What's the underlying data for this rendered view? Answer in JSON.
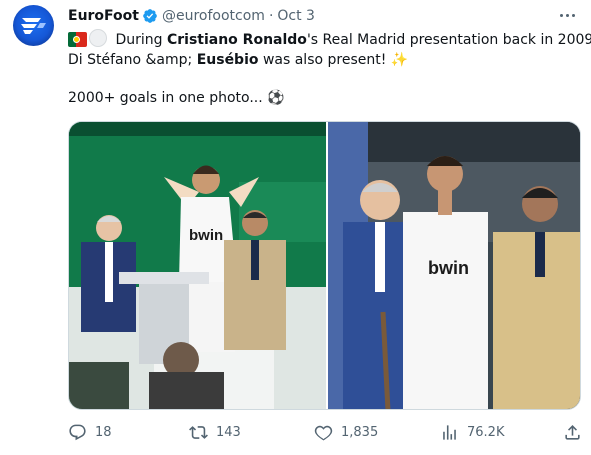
{
  "author": {
    "name": "EuroFoot",
    "handle": "@eurofootcom",
    "separator": "·",
    "date": "Oct 3",
    "verified": true,
    "avatar_icon": "eurofoot-logo-icon",
    "brand_color": "#1d5fe0"
  },
  "tweet": {
    "line1_pre": " During ",
    "line1_bold1": "Cristiano Ronaldo",
    "line1_post": "'s Real Madrid presentation back in 2009,",
    "line2_pre": "Di Stéfano &amp; ",
    "line2_bold": "Eusébio",
    "line2_post": " was also present! ",
    "line2_emoji": "✨",
    "line3_text": "2000+ goals in one photo... ",
    "line3_emoji": "⚽",
    "flags": [
      "portugal-flag-icon",
      "white-circle-icon"
    ]
  },
  "media": {
    "photo_left": "ronaldo-presentation-photo",
    "photo_right": "ronaldo-distefano-eusebio-photo",
    "left_shirt_text": "bwin",
    "right_shirt_text": "bwin"
  },
  "actions": {
    "replies": "18",
    "retweets": "143",
    "likes": "1,835",
    "views": "76.2K"
  },
  "colors": {
    "text": "#0f1419",
    "muted": "#536471",
    "verified": "#1d9bf0"
  }
}
